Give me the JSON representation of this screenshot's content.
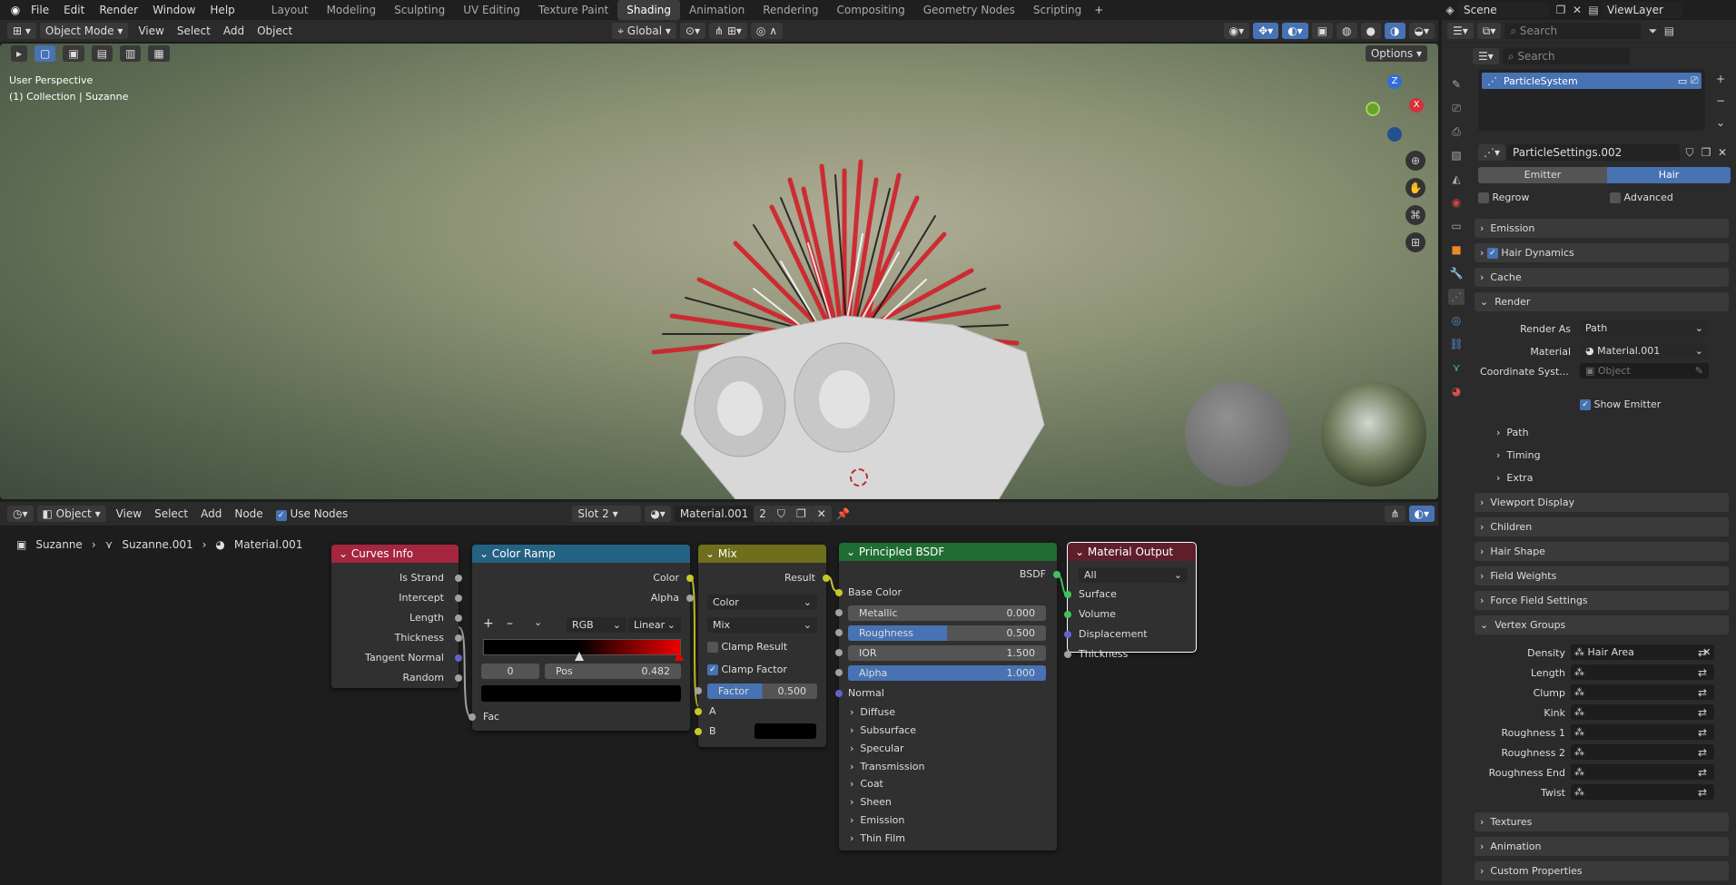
{
  "menus": [
    "File",
    "Edit",
    "Render",
    "Window",
    "Help"
  ],
  "workspaces": [
    "Layout",
    "Modeling",
    "Sculpting",
    "UV Editing",
    "Texture Paint",
    "Shading",
    "Animation",
    "Rendering",
    "Compositing",
    "Geometry Nodes",
    "Scripting"
  ],
  "active_workspace": "Shading",
  "scene": "Scene",
  "view_layer": "ViewLayer",
  "viewport": {
    "mode": "Object Mode",
    "menus": [
      "View",
      "Select",
      "Add",
      "Object"
    ],
    "transform": "Global",
    "options": "Options",
    "perspective": "User Perspective",
    "collection": "(1) Collection | Suzanne",
    "gizmo": {
      "z": "Z",
      "x": "X"
    }
  },
  "node_editor": {
    "editor_type": "Object",
    "menus": [
      "View",
      "Select",
      "Add",
      "Node"
    ],
    "use_nodes": "Use Nodes",
    "slot": "Slot 2",
    "material": "Material.001",
    "users": "2",
    "breadcrumb": [
      "Suzanne",
      "Suzanne.001",
      "Material.001"
    ],
    "nodes": {
      "curves_info": {
        "title": "Curves Info",
        "outputs": [
          "Is Strand",
          "Intercept",
          "Length",
          "Thickness",
          "Tangent Normal",
          "Random"
        ]
      },
      "color_ramp": {
        "title": "Color Ramp",
        "outputs": [
          "Color",
          "Alpha"
        ],
        "mode": "RGB",
        "interp": "Linear",
        "index": "0",
        "pos_label": "Pos",
        "pos_value": "0.482",
        "input": "Fac"
      },
      "mix": {
        "title": "Mix",
        "output": "Result",
        "type": "Color",
        "blend": "Mix",
        "clamp_result": "Clamp Result",
        "clamp_factor": "Clamp Factor",
        "factor_label": "Factor",
        "factor_value": "0.500",
        "a": "A",
        "b": "B"
      },
      "principled": {
        "title": "Principled BSDF",
        "output": "BSDF",
        "base_color": "Base Color",
        "fields": [
          {
            "label": "Metallic",
            "value": "0.000",
            "fill": 0
          },
          {
            "label": "Roughness",
            "value": "0.500",
            "fill": 0.5
          },
          {
            "label": "IOR",
            "value": "1.500",
            "fill": 0
          },
          {
            "label": "Alpha",
            "value": "1.000",
            "fill": 1
          }
        ],
        "normal": "Normal",
        "panels": [
          "Diffuse",
          "Subsurface",
          "Specular",
          "Transmission",
          "Coat",
          "Sheen",
          "Emission",
          "Thin Film"
        ]
      },
      "output": {
        "title": "Material Output",
        "target": "All",
        "inputs": [
          "Surface",
          "Volume",
          "Displacement",
          "Thickness"
        ]
      }
    }
  },
  "outliner": {
    "search_placeholder": "Search"
  },
  "properties": {
    "search_placeholder": "Search",
    "particle_system": "ParticleSystem",
    "settings": "ParticleSettings.002",
    "type_tabs": [
      "Emitter",
      "Hair"
    ],
    "regrow": "Regrow",
    "advanced": "Advanced",
    "sections_top": [
      "Emission",
      "Hair Dynamics",
      "Cache",
      "Render"
    ],
    "render_as_label": "Render As",
    "render_as": "Path",
    "material_label": "Material",
    "material": "Material.001",
    "coord_label": "Coordinate Syst...",
    "coord_placeholder": "Object",
    "show_emitter": "Show Emitter",
    "render_sub": [
      "Path",
      "Timing",
      "Extra"
    ],
    "sections_mid": [
      "Viewport Display",
      "Children",
      "Hair Shape",
      "Field Weights",
      "Force Field Settings",
      "Vertex Groups"
    ],
    "vertex_groups": [
      {
        "label": "Density",
        "value": "Hair Area"
      },
      {
        "label": "Length",
        "value": ""
      },
      {
        "label": "Clump",
        "value": ""
      },
      {
        "label": "Kink",
        "value": ""
      },
      {
        "label": "Roughness 1",
        "value": ""
      },
      {
        "label": "Roughness 2",
        "value": ""
      },
      {
        "label": "Roughness End",
        "value": ""
      },
      {
        "label": "Twist",
        "value": ""
      }
    ],
    "sections_bottom": [
      "Textures",
      "Animation",
      "Custom Properties"
    ]
  }
}
